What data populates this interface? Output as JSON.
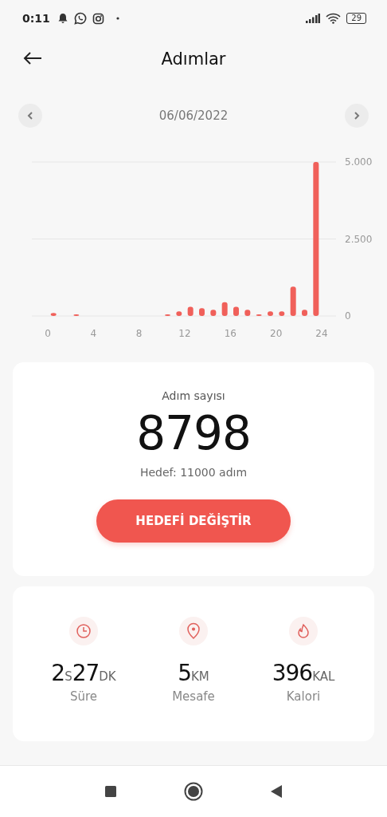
{
  "status_bar": {
    "time": "0:11",
    "battery": "29"
  },
  "header": {
    "title": "Adımlar"
  },
  "date_nav": {
    "date": "06/06/2022"
  },
  "chart_data": {
    "type": "bar",
    "x": [
      0.5,
      1.5,
      2.5,
      3.5,
      4.5,
      5.5,
      6.5,
      7.5,
      8.5,
      9.5,
      10.5,
      11.5,
      12.5,
      13.5,
      14.5,
      15.5,
      16.5,
      17.5,
      18.5,
      19.5,
      20.5,
      21.5,
      22.5,
      23.5
    ],
    "series": [
      {
        "color": "#f0605a",
        "values": [
          100,
          0,
          50,
          0,
          0,
          0,
          0,
          0,
          0,
          0,
          50,
          150,
          300,
          250,
          200,
          450,
          300,
          200,
          50,
          150,
          150,
          950,
          200,
          5000
        ]
      }
    ],
    "xlim": [
      0,
      24
    ],
    "ylim": [
      0,
      5000
    ],
    "xticks": [
      0,
      4,
      8,
      12,
      16,
      20,
      24
    ],
    "yticks": [
      {
        "value": 0,
        "label": "0"
      },
      {
        "value": 2500,
        "label": "2.500"
      },
      {
        "value": 5000,
        "label": "5.000"
      }
    ]
  },
  "steps_card": {
    "label": "Adım sayısı",
    "count": "8798",
    "goal": "Hedef: 11000 adım",
    "button": "HEDEFİ DEĞİŞTİR"
  },
  "stats": [
    {
      "kind": "clock",
      "parts": [
        {
          "num": "2",
          "unit": "S"
        },
        {
          "num": "27",
          "unit": "DK"
        }
      ],
      "label": "Süre"
    },
    {
      "kind": "pin",
      "parts": [
        {
          "num": "5",
          "unit": "KM"
        }
      ],
      "label": "Mesafe"
    },
    {
      "kind": "flame",
      "parts": [
        {
          "num": "396",
          "unit": "KAL"
        }
      ],
      "label": "Kalori"
    }
  ]
}
